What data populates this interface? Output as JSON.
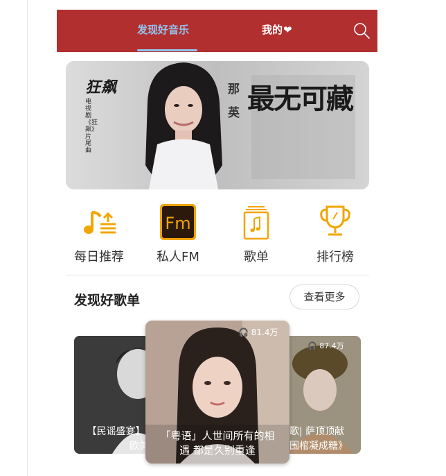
{
  "header": {
    "tab_discover": "发现好音乐",
    "tab_mine": "我的",
    "heart": "❤",
    "search_icon": "search-icon",
    "accent_color": "#b22f2f"
  },
  "banner": {
    "show_title": "狂飙",
    "show_desc": "电视剧《狂飙》片尾曲",
    "artist": "那英",
    "song": "最无可藏"
  },
  "quick_nav": [
    {
      "label": "每日推荐",
      "icon": "daily-recommend-icon"
    },
    {
      "label": "私人FM",
      "icon": "fm-icon"
    },
    {
      "label": "歌单",
      "icon": "playlist-icon"
    },
    {
      "label": "排行榜",
      "icon": "trophy-icon"
    }
  ],
  "section": {
    "title": "发现好歌单",
    "more": "查看更多"
  },
  "playlists": {
    "left": {
      "caption_line1": "【民谣盛宴】1",
      "caption_line2": "欧美民"
    },
    "center": {
      "plays": "81.4万",
      "caption_line1": "「粤语」人世间所有的相",
      "caption_line2": "遇 都是久别重逢"
    },
    "right": {
      "plays": "87.4万",
      "caption_line1": "热歌| 萨顶顶献",
      "caption_line2": "《围棺凝成糖》"
    }
  }
}
